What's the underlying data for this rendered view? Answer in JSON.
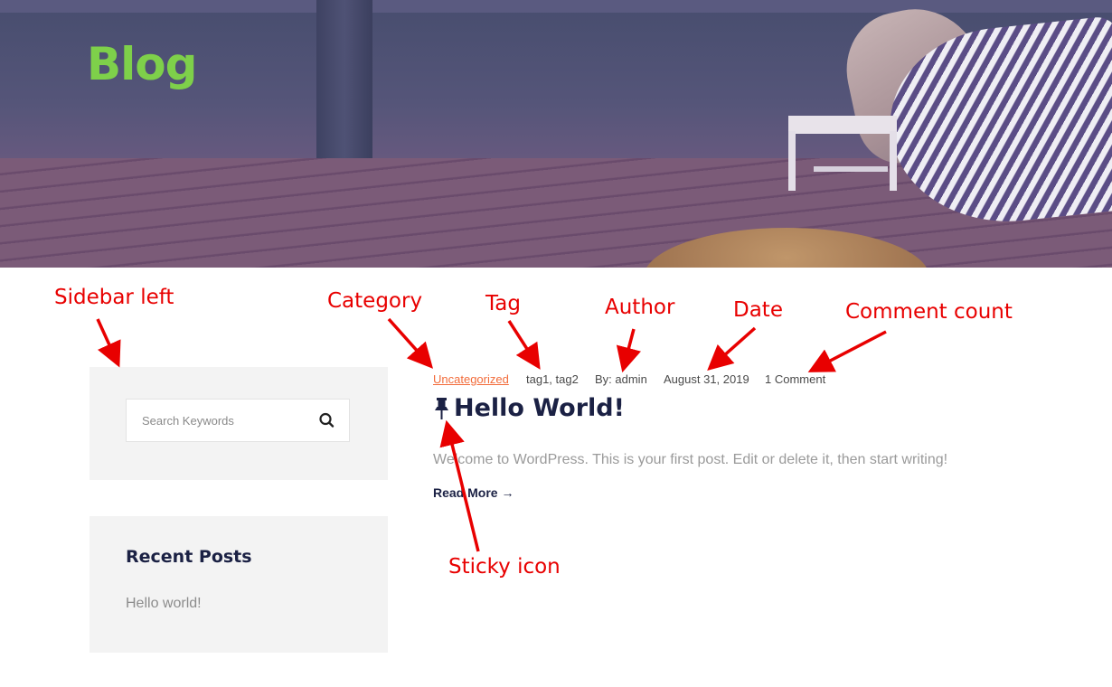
{
  "hero": {
    "title": "Blog"
  },
  "sidebar": {
    "search": {
      "placeholder": "Search Keywords"
    },
    "recent_posts": {
      "title": "Recent Posts",
      "items": [
        "Hello world!"
      ]
    }
  },
  "post": {
    "category": "Uncategorized",
    "tags": "tag1, tag2",
    "author": "By: admin",
    "date": "August 31, 2019",
    "comments": "1 Comment",
    "title": "Hello World!",
    "excerpt": "Welcome to WordPress. This is your first post. Edit or delete it, then start writing!",
    "read_more": "Read More →"
  },
  "annotations": {
    "sidebar_left": "Sidebar left",
    "category": "Category",
    "tag": "Tag",
    "author": "Author",
    "date": "Date",
    "comment_count": "Comment count",
    "sticky_icon": "Sticky icon"
  },
  "colors": {
    "hero_title": "#7ed04a",
    "category_link": "#f26b3a",
    "heading": "#1b2144",
    "annotation": "#e80000",
    "widget_bg": "#f3f3f3"
  },
  "icons": [
    "search-icon",
    "pushpin-icon",
    "arrow-right-icon"
  ]
}
